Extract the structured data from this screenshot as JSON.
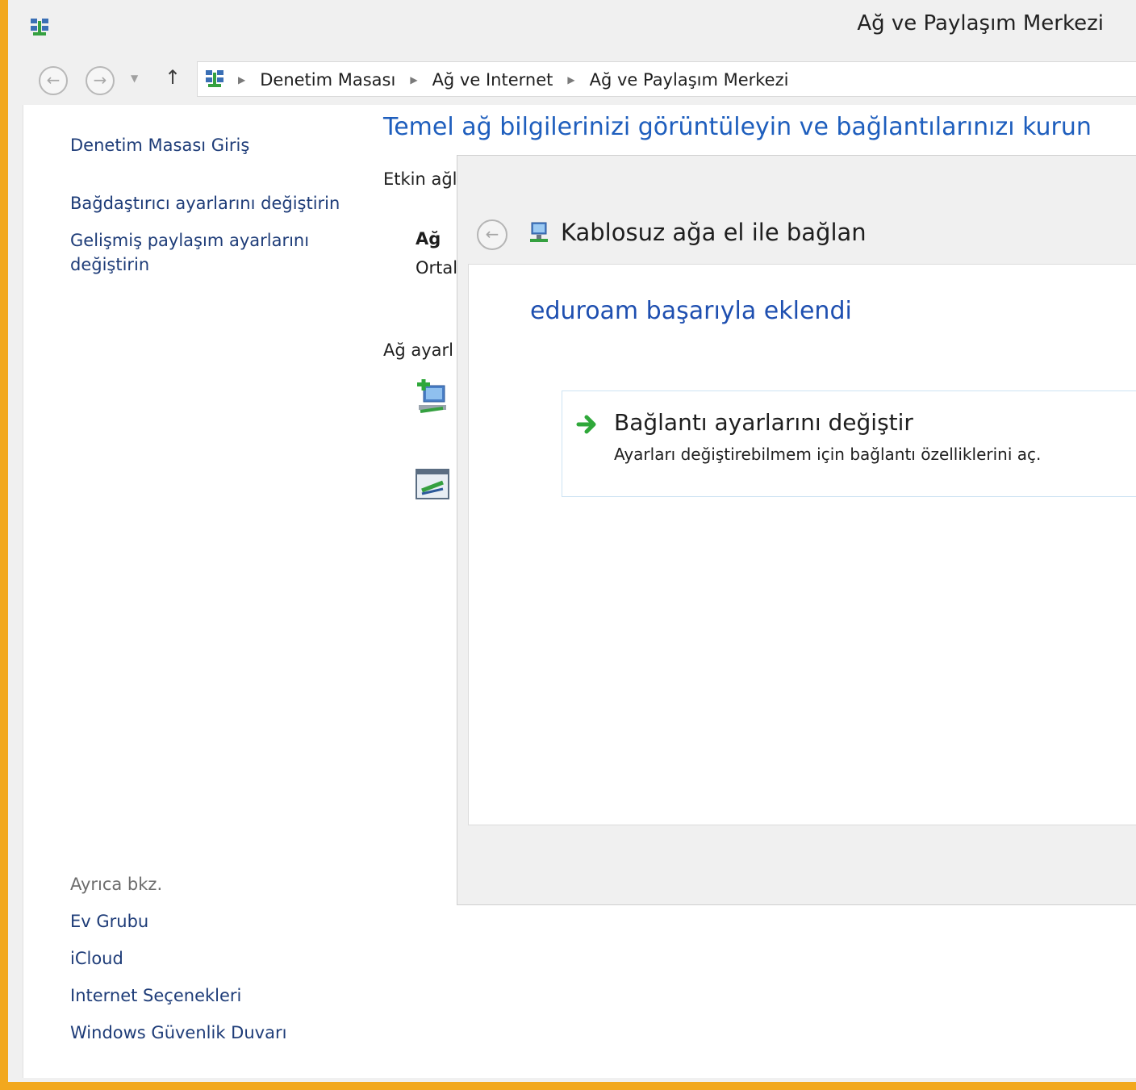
{
  "window": {
    "title": "Ağ ve Paylaşım Merkezi"
  },
  "navigation": {
    "back_icon": "back-arrow-icon",
    "forward_icon": "forward-arrow-icon",
    "up_icon": "up-arrow-icon",
    "breadcrumbs": [
      "Denetim Masası",
      "Ağ ve Internet",
      "Ağ ve Paylaşım Merkezi"
    ]
  },
  "sidebar": {
    "home_link": "Denetim Masası Giriş",
    "links": [
      "Bağdaştırıcı ayarlarını değiştirin",
      "Gelişmiş paylaşım ayarlarını",
      "değiştirin"
    ],
    "see_also_label": "Ayrıca bkz.",
    "see_also_links": [
      "Ev Grubu",
      "iCloud",
      "Internet Seçenekleri",
      "Windows Güvenlik Duvarı"
    ]
  },
  "main": {
    "title": "Temel ağ bilgilerinizi görüntüleyin ve bağlantılarınızı kurun",
    "active_networks_label": "Etkin ağl",
    "network_name": "Ağ",
    "network_type": "Ortal",
    "settings_label": "Ağ ayarl"
  },
  "dialog": {
    "title": "Kablosuz ağa el ile bağlan",
    "heading": "eduroam başarıyla eklendi",
    "option": {
      "title": "Bağlantı ayarlarını değiştir",
      "description": "Ayarları değiştirebilmem için bağlantı özelliklerini aç."
    }
  },
  "colors": {
    "frame": "#f2a81e",
    "link": "#1e3c78",
    "heading_blue": "#1e5ebd",
    "arrow_green": "#2fa83a"
  }
}
